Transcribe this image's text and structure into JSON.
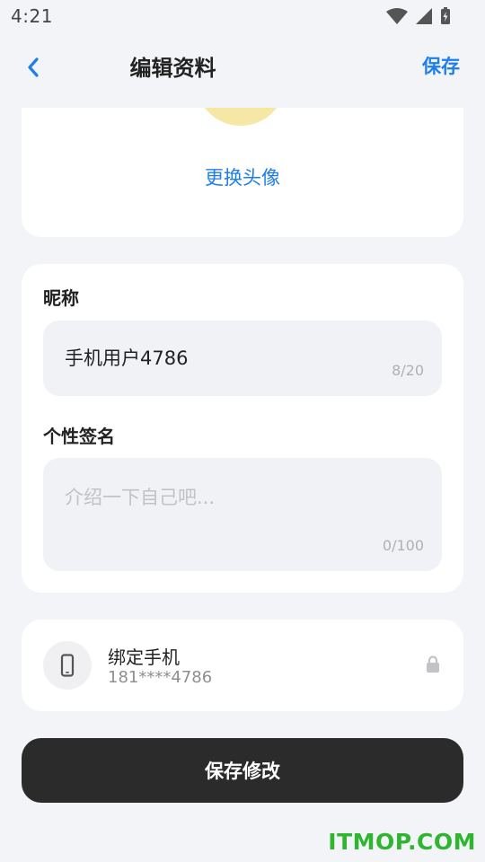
{
  "status_bar": {
    "time": "4:21"
  },
  "nav": {
    "title": "编辑资料",
    "save_label": "保存"
  },
  "avatar": {
    "change_label": "更换头像"
  },
  "profile": {
    "nickname_label": "昵称",
    "nickname_value": "手机用户4786",
    "nickname_counter": "8/20",
    "bio_label": "个性签名",
    "bio_placeholder": "介绍一下自己吧...",
    "bio_counter": "0/100"
  },
  "phone": {
    "title": "绑定手机",
    "number": "181****4786"
  },
  "footer": {
    "save_button_label": "保存修改"
  },
  "watermark": "ITMOP.COM",
  "colors": {
    "accent": "#1f7ee8",
    "background": "#f3f4f8",
    "dark_button": "#2b2b2b",
    "watermark": "#2fb52f"
  }
}
